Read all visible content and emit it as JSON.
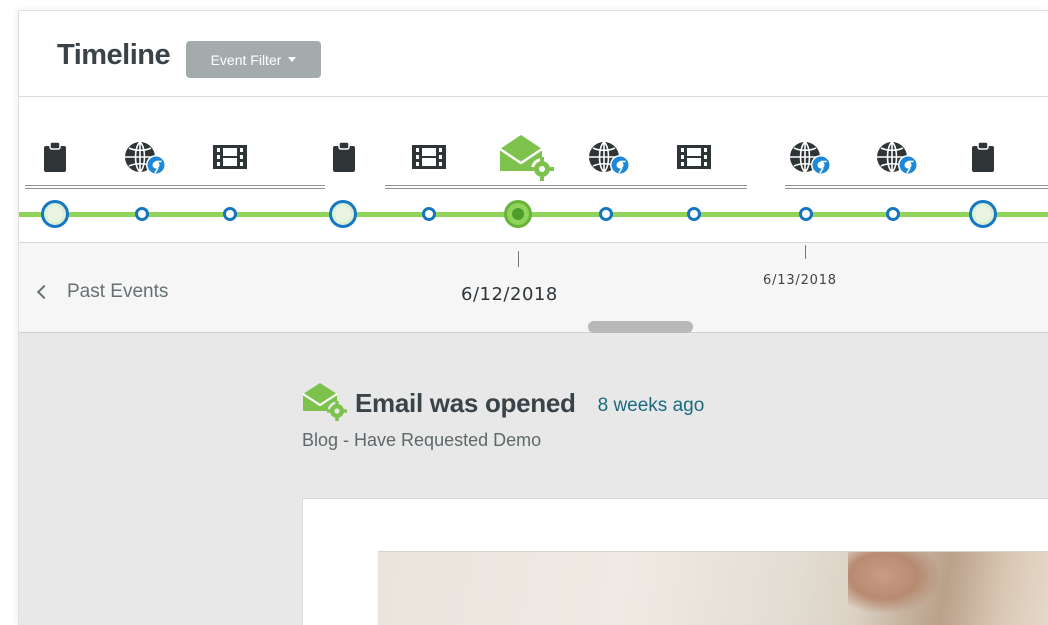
{
  "header": {
    "title": "Timeline",
    "filter_label": "Event Filter"
  },
  "timeline": {
    "icons": [
      "clipboard-icon",
      "chrome-globe-icon",
      "film-icon",
      "clipboard-icon",
      "film-icon",
      "email-gear-icon",
      "chrome-globe-icon",
      "film-icon",
      "chrome-globe-icon",
      "chrome-globe-icon",
      "clipboard-icon"
    ],
    "nodes": [
      "large",
      "small",
      "small",
      "large",
      "small",
      "active",
      "small",
      "small",
      "small",
      "small",
      "large"
    ],
    "accent_green": "#8fd35a",
    "accent_blue": "#1775be"
  },
  "dates": {
    "past_events_label": "Past Events",
    "current_date": "6/12/2018",
    "next_date": "6/13/2018"
  },
  "event": {
    "icon": "email-gear-icon",
    "title": "Email was opened",
    "time_ago": "8 weeks ago",
    "subtitle": "Blog - Have Requested Demo"
  }
}
